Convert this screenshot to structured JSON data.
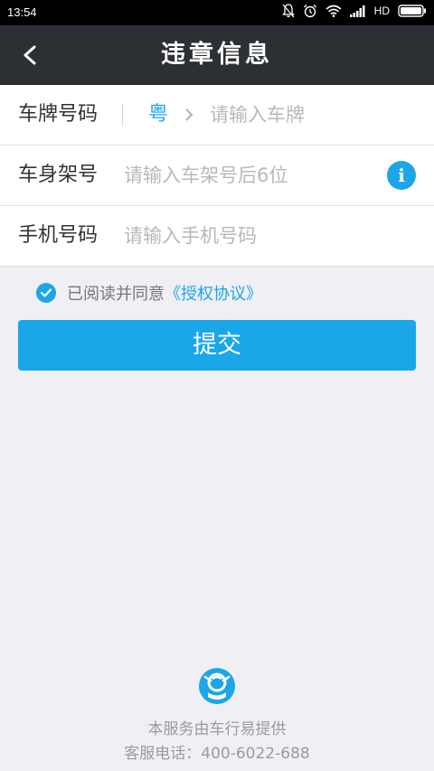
{
  "status_bar": {
    "time": "13:54",
    "network": "HD"
  },
  "header": {
    "title": "违章信息",
    "back_icon": "back-chevron-icon"
  },
  "form": {
    "plate": {
      "label": "车牌号码",
      "province": "粤",
      "placeholder": "请输入车牌"
    },
    "frame": {
      "label": "车身架号",
      "placeholder": "请输入车架号后6位",
      "info_icon": "info-icon",
      "info_glyph": "i"
    },
    "phone": {
      "label": "手机号码",
      "placeholder": "请输入手机号码"
    }
  },
  "agreement": {
    "text": "已阅读并同意",
    "link": "《授权协议》",
    "checked": true
  },
  "submit_label": "提交",
  "footer": {
    "provider": "本服务由车行易提供",
    "hotline": "客服电话：400-6022-688"
  },
  "colors": {
    "accent": "#1da6e6",
    "navbar": "#2c2f33",
    "background": "#efeff4"
  }
}
